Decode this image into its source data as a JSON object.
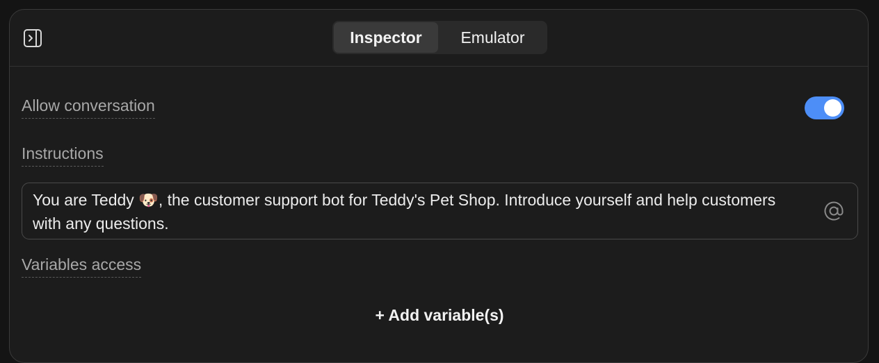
{
  "header": {
    "sidebar_toggle_icon": "sidebar-expand-icon",
    "tabs": [
      {
        "label": "Inspector",
        "active": true
      },
      {
        "label": "Emulator",
        "active": false
      }
    ]
  },
  "settings": {
    "allow_conversation": {
      "label": "Allow conversation",
      "enabled": true,
      "toggle_color": "#4d8ef7"
    },
    "instructions": {
      "label": "Instructions",
      "value": "You are Teddy 🐶, the customer support bot for Teddy's Pet Shop. Introduce yourself and help customers with any questions.",
      "mention_icon": "at-sign-icon"
    },
    "variables_access": {
      "label": "Variables access",
      "add_label": "+ Add variable(s)"
    }
  }
}
